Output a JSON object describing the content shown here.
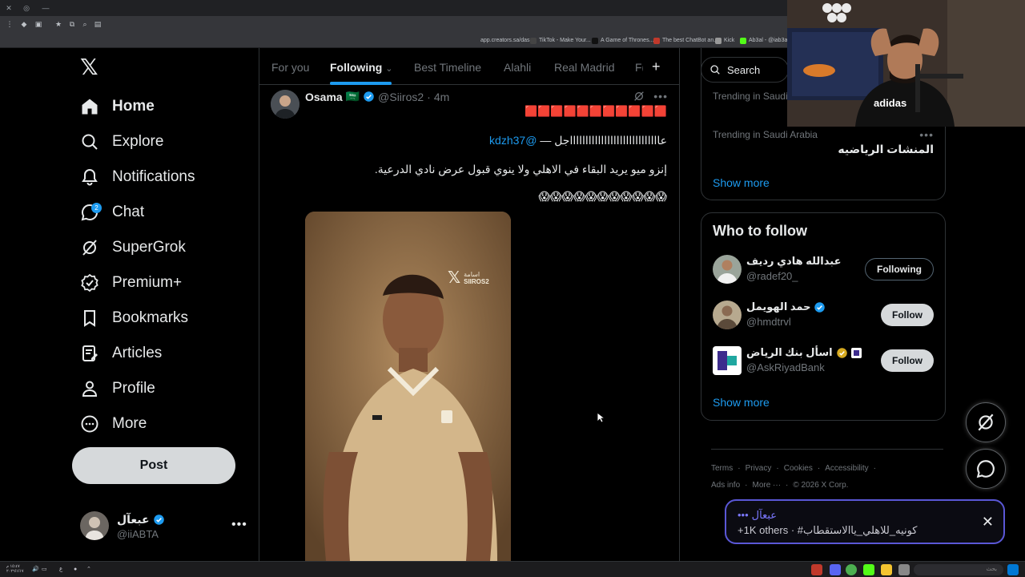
{
  "browser": {
    "bookmarks": [
      "app.creators.sa/das...",
      "TikTok - Make Your...",
      "A Game of Thrones...",
      "The best ChatBot an...",
      "Kick",
      "Ab3al - @iab3al"
    ]
  },
  "sidebar": {
    "items": [
      {
        "label": "Home"
      },
      {
        "label": "Explore"
      },
      {
        "label": "Notifications"
      },
      {
        "label": "Chat",
        "badge": "2"
      },
      {
        "label": "SuperGrok"
      },
      {
        "label": "Premium+"
      },
      {
        "label": "Bookmarks"
      },
      {
        "label": "Articles"
      },
      {
        "label": "Profile"
      },
      {
        "label": "More"
      }
    ],
    "post_label": "Post",
    "account": {
      "name": "عبعآل",
      "handle": "@iiABTA"
    }
  },
  "tabs": [
    {
      "label": "For you"
    },
    {
      "label": "Following"
    },
    {
      "label": "Best Timeline"
    },
    {
      "label": "Alahli"
    },
    {
      "label": "Real Madrid"
    },
    {
      "label": "F("
    }
  ],
  "tweet": {
    "name": "Osama",
    "flag": "🇸🇦",
    "handle": "@Siiros2",
    "time": "4m",
    "line1": "🟥🟥🟥🟥🟥🟥🟥🟥🟥🟥🟥",
    "line2_text": "عاااااااااااااااااااااااااااااجل —",
    "line2_mention": "@kdzh37",
    "line3": "إنزو ميو يريد البقاء في الاهلي ولا ينوي قبول عرض نادي الدرعية.",
    "line4": "😱😱😱😱😱😱😱😱😱😱😱",
    "media_watermark": "اسامة",
    "media_watermark_sub": "SIIROS2"
  },
  "right": {
    "search_placeholder": "Search",
    "trend_meta_top": "Trending in Saudi",
    "trend_meta": "Trending in Saudi Arabia",
    "trend_title": "المنشات الرياضيه",
    "show_more": "Show more",
    "wtf_title": "Who to follow",
    "wtf": [
      {
        "name": "عبدالله هادي رديف",
        "handle": "@radef20_",
        "button": "Following"
      },
      {
        "name": "حمد الهويمل",
        "handle": "@hmdtrvl",
        "button": "Follow"
      },
      {
        "name": "اسأل بنك الرياض",
        "handle": "@AskRiyadBank",
        "button": "Follow"
      }
    ],
    "footer": {
      "row1": [
        "Terms",
        "·",
        "Privacy",
        "·",
        "Cookies",
        "·",
        "Accessibility",
        "·"
      ],
      "row2": [
        "Ads info",
        "·",
        "More ···",
        "·",
        "© 2026 X Corp."
      ]
    }
  },
  "toast": {
    "line1_name": "عبعآل",
    "line1_dots": "•••",
    "line2": "+1K others · #كونيه_للاهلي_ياالاستقطاب"
  },
  "taskbar": {
    "clock": "١٥:٤٧ م\n٢٠٢٦/١/١٧",
    "lang": "ع",
    "search": "بحث"
  },
  "colors": {
    "accent": "#1d9bf0",
    "background": "#000000",
    "border": "#2f3336",
    "muted": "#71767b",
    "toast_border": "#5a57d6"
  }
}
